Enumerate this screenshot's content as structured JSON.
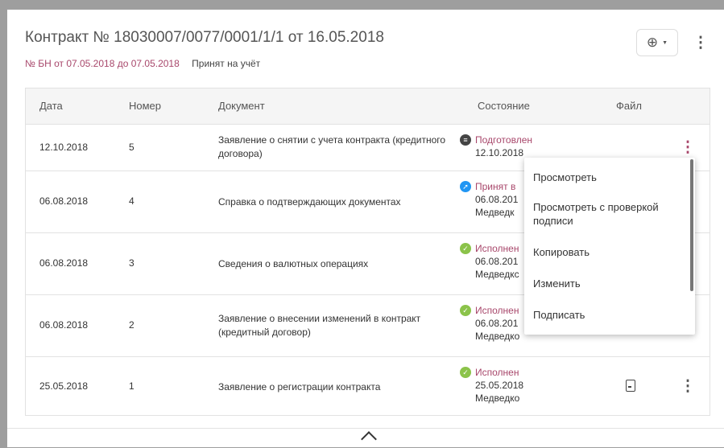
{
  "header": {
    "title": "Контракт № 18030007/0077/0001/1/1 от 16.05.2018",
    "period": "№ БН от 07.05.2018 до 07.05.2018",
    "status": "Принят на учёт",
    "add_icon": "plus-circle-icon",
    "caret_icon": "caret-down-icon",
    "more_icon": "more-vertical-icon"
  },
  "table": {
    "columns": [
      "Дата",
      "Номер",
      "Документ",
      "Состояние",
      "Файл"
    ],
    "rows": [
      {
        "date": "12.10.2018",
        "number": "5",
        "document": "Заявление о снятии с учета контракта (кредитного договора)",
        "state": "Подготовлен",
        "state_date": "12.10.2018",
        "state_person": "",
        "state_icon": "draft-icon",
        "state_color": "#444444"
      },
      {
        "date": "06.08.2018",
        "number": "4",
        "document": "Справка о подтверждающих документах",
        "state": "Принят в",
        "state_date": "06.08.201",
        "state_person": "Медведк",
        "state_icon": "accepted-icon",
        "state_color": "#2196f3"
      },
      {
        "date": "06.08.2018",
        "number": "3",
        "document": "Сведения о валютных операциях",
        "state": "Исполнен",
        "state_date": "06.08.201",
        "state_person": "Медведкс",
        "state_icon": "check-icon",
        "state_color": "#8bc34a"
      },
      {
        "date": "06.08.2018",
        "number": "2",
        "document": "Заявление о внесении изменений в контракт (кредитный договор)",
        "state": "Исполнен",
        "state_date": "06.08.201",
        "state_person": "Медведко",
        "state_icon": "check-icon",
        "state_color": "#8bc34a"
      },
      {
        "date": "25.05.2018",
        "number": "1",
        "document": "Заявление о регистрации контракта",
        "state": "Исполнен",
        "state_date": "25.05.2018",
        "state_person": "Медведко",
        "state_icon": "check-icon",
        "state_color": "#8bc34a",
        "file_icon": "file-icon"
      }
    ]
  },
  "context_menu": {
    "items": [
      "Просмотреть",
      "Просмотреть с проверкой подписи",
      "Копировать",
      "Изменить",
      "Подписать"
    ]
  },
  "footer": {
    "collapse_icon": "chevron-up-icon"
  },
  "colors": {
    "accent": "#a8476b",
    "success": "#8bc34a",
    "info": "#2196f3"
  }
}
